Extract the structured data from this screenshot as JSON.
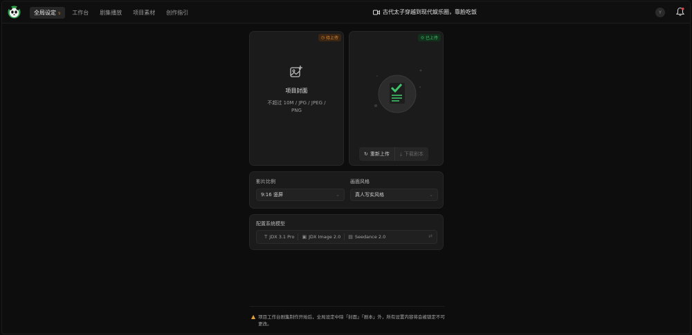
{
  "nav": {
    "items": [
      {
        "label": "全局设定",
        "active": true
      },
      {
        "label": "工作台"
      },
      {
        "label": "剧集播放"
      },
      {
        "label": "项目素材"
      },
      {
        "label": "创作指引"
      }
    ]
  },
  "project": {
    "title": "古代太子穿越到现代娱乐圈，靠脸吃饭"
  },
  "user": {
    "avatar_letter": "Y"
  },
  "cover": {
    "badge": "待上传",
    "title": "项目封面",
    "subtitle": "不超过 10M / JPG / JPEG / PNG"
  },
  "script": {
    "badge": "已上传",
    "reupload_label": "重新上传",
    "download_label": "下载剧本"
  },
  "settings": {
    "ratio_label": "影片比例",
    "ratio_value": "9:16 竖屏",
    "style_label": "画面风格",
    "style_value": "真人写实风格"
  },
  "models": {
    "label": "配置系统模型",
    "items": [
      {
        "icon": "text-icon",
        "name": "JDX 3.1 Pro"
      },
      {
        "icon": "image-icon",
        "name": "JDX Image 2.0"
      },
      {
        "icon": "video-icon",
        "name": "Seedance 2.0"
      }
    ]
  },
  "footer": {
    "note": "项目工作台剧集制作开始后，全局设定中除「封面」「剧本」外，所有设置内容将会被锁定不可更改。"
  },
  "colors": {
    "accent_green": "#3ec46a",
    "accent_orange": "#e38a32",
    "background": "#0d0d0d",
    "card": "#1b1b1b"
  }
}
